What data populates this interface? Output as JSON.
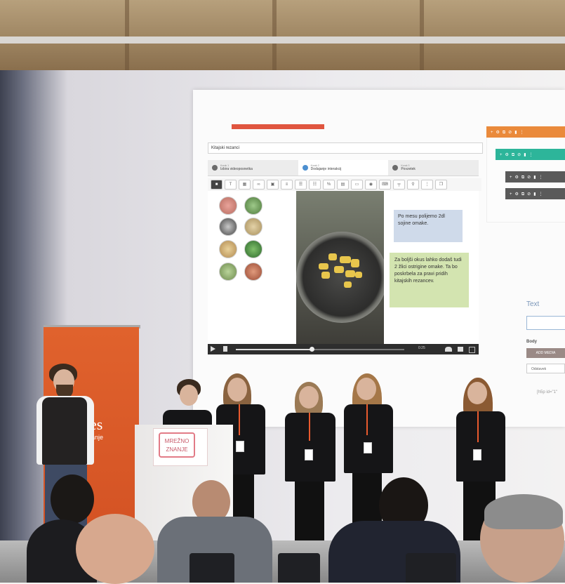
{
  "slide": {
    "title_input": "Kitajski rezanci",
    "tabs": [
      {
        "step": "Korak 1",
        "label": "Izbira videoposnetka"
      },
      {
        "step": "Korak 2",
        "label": "Dodajanje interakcij"
      },
      {
        "step": "Korak 3",
        "label": "Povzetek"
      }
    ],
    "toolbar_icons": [
      "bold-icon",
      "text-icon",
      "table-icon",
      "link-icon",
      "image-icon",
      "list-icon",
      "numbered-list-icon",
      "bullet-list-icon",
      "percent-icon",
      "table2-icon",
      "speech-bubble-icon",
      "eye-icon",
      "keyboard-icon",
      "separator-icon",
      "zoom-icon",
      "more-icon",
      "copy-icon"
    ],
    "bubble_blue": "Po mesu polijemo 2dl sojine omake.",
    "bubble_green": "Za boljši okus lahko dodaš tudi 2 žlici ostrigine omake. Ta bo poskrbela za pravi pridih kitajskih rezancev.",
    "player": {
      "time": "0:25",
      "progress": 0.45
    },
    "side_panel": {
      "text_heading": "Text",
      "body_label": "Body",
      "add_media": "ADD MEDIA",
      "paragraph_select": "Odstavek",
      "code_snippet": "[h5p id=\"1\""
    },
    "colors": {
      "accent_red": "#e0553f",
      "panel_orange": "#ea8a3b",
      "panel_teal": "#2db59a",
      "bubble_blue": "#cfdaea",
      "bubble_green": "#d3e4b0"
    }
  },
  "banner": {
    "text": "es",
    "subtext": "anje"
  },
  "podium": {
    "logo_text": "MREŽNO ZNANJE"
  }
}
